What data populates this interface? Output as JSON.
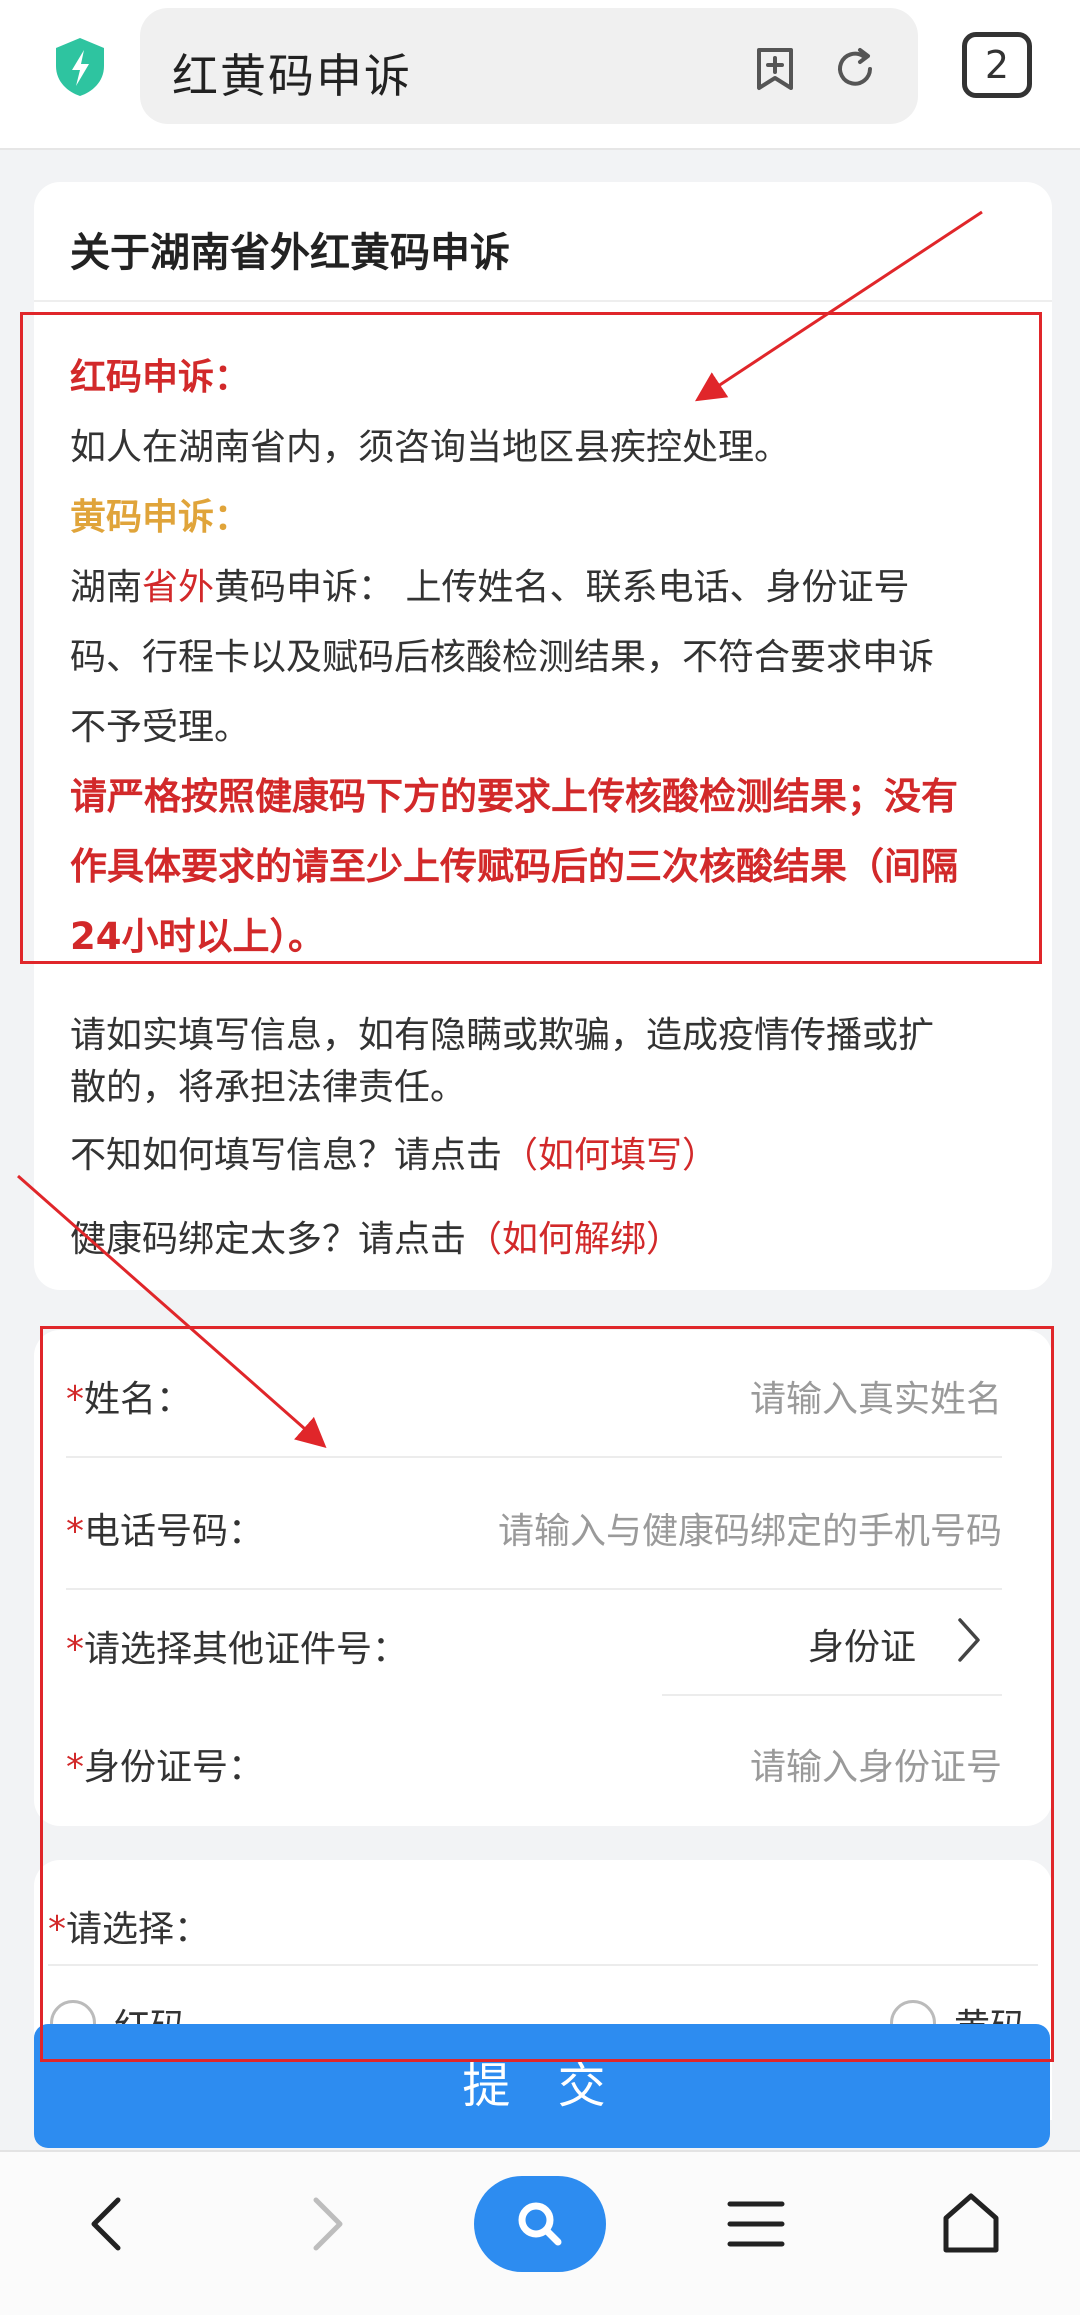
{
  "browser": {
    "url_text": "红黄码申诉",
    "tab_count": "2",
    "icons": [
      "shield-icon",
      "bookmark-add-icon",
      "refresh-icon"
    ]
  },
  "info_card": {
    "title": "关于湖南省外红黄码申诉",
    "red_heading": "红码申诉：",
    "red_text": "如人在湖南省内，须咨询当地区县疾控处理。",
    "yellow_heading": "黄码申诉：",
    "yellow_line1_a": "湖南",
    "yellow_line1_b": "省外",
    "yellow_line1_c": "黄码申诉： 上传姓名、联系电话、身份证号",
    "yellow_line2": "码、行程卡以及赋码后核酸检测结果，不符合要求申诉",
    "yellow_line3": "不予受理。",
    "bold_line1": "请严格按照健康码下方的要求上传核酸检测结果；没有",
    "bold_line2": "作具体要求的请至少上传赋码后的三次核酸结果（间隔",
    "bold_line3": "24小时以上）。",
    "notice_line1": "请如实填写信息，如有隐瞒或欺骗，造成疫情传播或扩",
    "notice_line2": "散的，将承担法律责任。",
    "help1_text": "不知如何填写信息？请点击",
    "help1_link": "（如何填写）",
    "help2_text": "健康码绑定太多？请点击",
    "help2_link": "（如何解绑）"
  },
  "form": {
    "required_mark": "*",
    "name_label": "姓名：",
    "name_placeholder": "请输入真实姓名",
    "phone_label": "电话号码：",
    "phone_placeholder": "请输入与健康码绑定的手机号码",
    "idtype_label": "请选择其他证件号：",
    "idtype_value": "身份证",
    "idnum_label": "身份证号：",
    "idnum_placeholder": "请输入身份证号",
    "choose_label": "请选择：",
    "option_red": "红码",
    "option_yellow": "黄码",
    "submit_label": "提 交"
  },
  "bottom_nav": {
    "icons": [
      "back-icon",
      "forward-icon",
      "search-icon",
      "menu-icon",
      "home-icon"
    ]
  },
  "colors": {
    "accent_blue": "#2d8cf0",
    "annotation_red": "#e0262a",
    "warning_red": "#d2292a",
    "yellow_heading": "#e0a43a"
  }
}
